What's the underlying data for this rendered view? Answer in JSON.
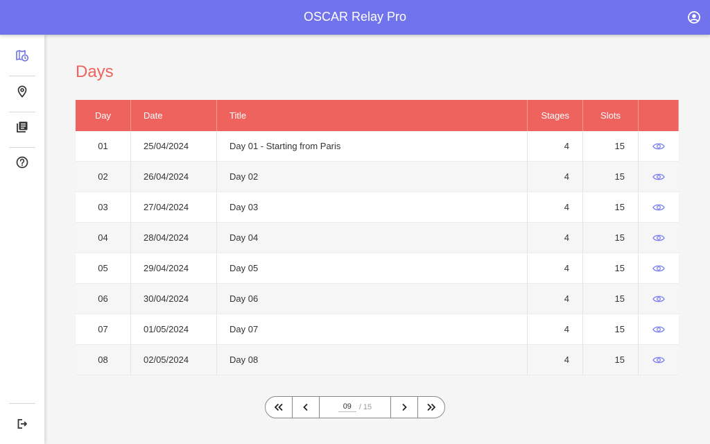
{
  "header": {
    "title": "OSCAR Relay Pro"
  },
  "sidebar": {
    "items": [
      {
        "icon": "map-clock-icon",
        "name": "days",
        "active": true
      },
      {
        "icon": "map-pin-icon",
        "name": "locations"
      },
      {
        "icon": "library-books-icon",
        "name": "documents"
      },
      {
        "icon": "help-icon",
        "name": "help"
      }
    ],
    "footer_icon": "logout-icon"
  },
  "page": {
    "title": "Days"
  },
  "table": {
    "columns": [
      "Day",
      "Date",
      "Title",
      "Stages",
      "Slots",
      ""
    ],
    "rows": [
      {
        "day": "01",
        "date": "25/04/2024",
        "title": "Day 01 - Starting from Paris",
        "stages": "4",
        "slots": "15"
      },
      {
        "day": "02",
        "date": "26/04/2024",
        "title": "Day 02",
        "stages": "4",
        "slots": "15"
      },
      {
        "day": "03",
        "date": "27/04/2024",
        "title": "Day 03",
        "stages": "4",
        "slots": "15"
      },
      {
        "day": "04",
        "date": "28/04/2024",
        "title": "Day 04",
        "stages": "4",
        "slots": "15"
      },
      {
        "day": "05",
        "date": "29/04/2024",
        "title": "Day 05",
        "stages": "4",
        "slots": "15"
      },
      {
        "day": "06",
        "date": "30/04/2024",
        "title": "Day 06",
        "stages": "4",
        "slots": "15"
      },
      {
        "day": "07",
        "date": "01/05/2024",
        "title": "Day 07",
        "stages": "4",
        "slots": "15"
      },
      {
        "day": "08",
        "date": "02/05/2024",
        "title": "Day 08",
        "stages": "4",
        "slots": "15"
      }
    ]
  },
  "pagination": {
    "current": "09",
    "total_label": "/ 15"
  },
  "colors": {
    "primary": "#7073ec",
    "accent": "#ee635d"
  }
}
